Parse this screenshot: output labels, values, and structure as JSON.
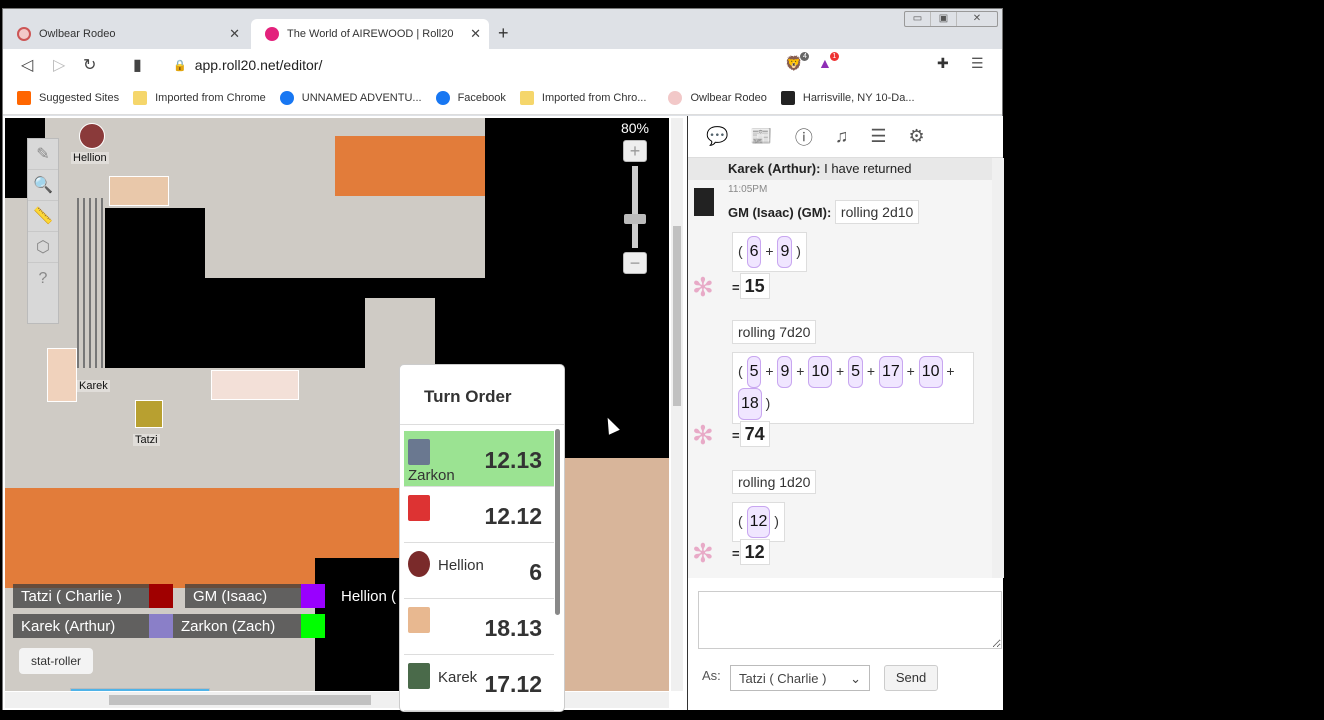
{
  "browser": {
    "tabs": [
      {
        "title": "Owlbear Rodeo",
        "active": false
      },
      {
        "title": "The World of AIREWOOD | Roll20",
        "active": true
      }
    ],
    "url": "app.roll20.net/editor/",
    "extensions": {
      "brave_count": "4",
      "alert_count": "1"
    },
    "bookmarks": [
      "Suggested Sites",
      "Imported from Chrome",
      "UNNAMED ADVENTU...",
      "Facebook",
      "Imported from Chro...",
      "Owlbear Rodeo",
      "Harrisville, NY 10-Da..."
    ]
  },
  "map": {
    "zoom": "80%",
    "zoom_level_fraction": 0.3,
    "tokens": [
      "Hellion",
      "Karek",
      "Tatzi"
    ],
    "tool_icons": [
      "select-icon",
      "draw-icon",
      "zoom-icon",
      "measure-icon",
      "dice-icon",
      "help-icon"
    ],
    "players": [
      {
        "name": "Tatzi ( Charlie )",
        "color": "#a00000"
      },
      {
        "name": "GM (Isaac)",
        "color": "#9900ff"
      },
      {
        "name": "Hellion (",
        "color": ""
      },
      {
        "name": "Karek (Arthur)",
        "color": "#8a7fc8"
      },
      {
        "name": "Zarkon (Zach)",
        "color": "#00ff00"
      }
    ],
    "stat_roller": "stat-roller"
  },
  "turn_order": {
    "title": "Turn Order",
    "entries": [
      {
        "name": "Zarkon",
        "value": "12.13",
        "current": true
      },
      {
        "name": "",
        "value": "12.12",
        "current": false
      },
      {
        "name": "Hellion",
        "value": "6",
        "current": false
      },
      {
        "name": "",
        "value": "18.13",
        "current": false
      },
      {
        "name": "Karek",
        "value": "17.12",
        "current": false
      }
    ]
  },
  "chat": {
    "prev_message": {
      "who": "Karek (Arthur):",
      "text": "I have returned"
    },
    "time": "11:05PM",
    "sender": "GM (Isaac) (GM):",
    "rolls": [
      {
        "label": "rolling 2d10",
        "dice": [
          "6",
          "9"
        ],
        "total": "15"
      },
      {
        "label": "rolling 7d20",
        "dice": [
          "5",
          "9",
          "10",
          "5",
          "17",
          "10",
          "18"
        ],
        "total": "74"
      },
      {
        "label": "rolling 1d20",
        "dice": [
          "12"
        ],
        "total": "12"
      }
    ],
    "as_label": "As:",
    "as_value": "Tatzi ( Charlie )",
    "send": "Send"
  }
}
